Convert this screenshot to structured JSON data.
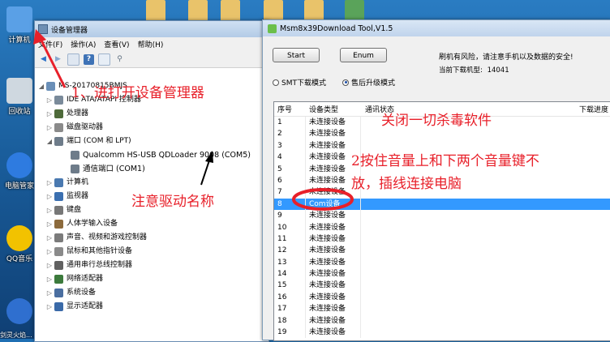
{
  "desktop": {
    "icons": [
      {
        "label": "计算机",
        "icon": "computer-icon",
        "color": "#5aa0e6"
      },
      {
        "label": "回收站",
        "icon": "recycle-bin-icon",
        "color": "#cfd8e0"
      },
      {
        "label": "电脑管家",
        "icon": "pc-manager-shield-icon",
        "color": "#2e7be0"
      },
      {
        "label": "QQ音乐",
        "icon": "qq-music-icon",
        "color": "#f2c200"
      },
      {
        "label": "",
        "icon": "sogou-icon",
        "color": "#2f6fcf"
      }
    ],
    "bottom_label": "剑灵火焰..."
  },
  "device_manager": {
    "title": "设备管理器",
    "menu": [
      "文件(F)",
      "操作(A)",
      "查看(V)",
      "帮助(H)"
    ],
    "toolbar_icons": [
      "back-arrow-icon",
      "forward-arrow-icon",
      "properties-icon",
      "help-icon",
      "view-icon",
      "scan-hardware-icon"
    ],
    "tree": [
      {
        "label": "MS-20170815BMJS",
        "level": 0,
        "expander": "◢",
        "icon": "computer-icon",
        "color": "#6a8fb8"
      },
      {
        "label": "IDE ATA/ATAPI 控制器",
        "level": 1,
        "expander": "▷",
        "icon": "ide-controller-icon",
        "color": "#7a8a9a"
      },
      {
        "label": "处理器",
        "level": 1,
        "expander": "▷",
        "icon": "processor-icon",
        "color": "#4e6a3a"
      },
      {
        "label": "磁盘驱动器",
        "level": 1,
        "expander": "▷",
        "icon": "disk-drive-icon",
        "color": "#8a8a8a"
      },
      {
        "label": "端口 (COM 和 LPT)",
        "level": 1,
        "expander": "◢",
        "icon": "port-icon",
        "color": "#6e7c8a"
      },
      {
        "label": "Qualcomm HS-USB QDLoader 9008 (COM5)",
        "level": 2,
        "expander": "",
        "icon": "port-device-icon",
        "color": "#6e7c8a"
      },
      {
        "label": "通信端口 (COM1)",
        "level": 2,
        "expander": "",
        "icon": "port-device-icon",
        "color": "#6e7c8a"
      },
      {
        "label": "计算机",
        "level": 1,
        "expander": "▷",
        "icon": "computer-node-icon",
        "color": "#4a79b0"
      },
      {
        "label": "监视器",
        "level": 1,
        "expander": "▷",
        "icon": "monitor-icon",
        "color": "#3b6fb0"
      },
      {
        "label": "键盘",
        "level": 1,
        "expander": "▷",
        "icon": "keyboard-icon",
        "color": "#777777"
      },
      {
        "label": "人体学输入设备",
        "level": 1,
        "expander": "▷",
        "icon": "hid-icon",
        "color": "#8c6a3c"
      },
      {
        "label": "声音、视频和游戏控制器",
        "level": 1,
        "expander": "▷",
        "icon": "sound-icon",
        "color": "#7b7b7b"
      },
      {
        "label": "鼠标和其他指针设备",
        "level": 1,
        "expander": "▷",
        "icon": "mouse-icon",
        "color": "#8a8a8a"
      },
      {
        "label": "通用串行总线控制器",
        "level": 1,
        "expander": "▷",
        "icon": "usb-icon",
        "color": "#606060"
      },
      {
        "label": "网络适配器",
        "level": 1,
        "expander": "▷",
        "icon": "network-adapter-icon",
        "color": "#3c7a3c"
      },
      {
        "label": "系统设备",
        "level": 1,
        "expander": "▷",
        "icon": "system-device-icon",
        "color": "#4a6ea0"
      },
      {
        "label": "显示适配器",
        "level": 1,
        "expander": "▷",
        "icon": "display-adapter-icon",
        "color": "#3a6aa8"
      }
    ]
  },
  "tool": {
    "title": "Msm8x39Download Tool,V1.5",
    "start_label": "Start",
    "enum_label": "Enum",
    "warning": "刷机有风险，请注意手机以及数据的安全!",
    "model_label": "当前下载机型:",
    "model_value": "14041",
    "mode_smt": "SMT下载模式",
    "mode_aftersale": "售后升级模式",
    "selected_mode": "售后升级模式",
    "columns": {
      "num": "序号",
      "type": "设备类型",
      "status": "通讯状态",
      "progress": "下载进度"
    },
    "rows": [
      {
        "num": "1",
        "type": "未连接设备"
      },
      {
        "num": "2",
        "type": "未连接设备"
      },
      {
        "num": "3",
        "type": "未连接设备"
      },
      {
        "num": "4",
        "type": "未连接设备"
      },
      {
        "num": "5",
        "type": "未连接设备"
      },
      {
        "num": "6",
        "type": "未连接设备"
      },
      {
        "num": "7",
        "type": "未连接设备"
      },
      {
        "num": "8",
        "type": "Com设备",
        "selected": true
      },
      {
        "num": "9",
        "type": "未连接设备"
      },
      {
        "num": "10",
        "type": "未连接设备"
      },
      {
        "num": "11",
        "type": "未连接设备"
      },
      {
        "num": "12",
        "type": "未连接设备"
      },
      {
        "num": "13",
        "type": "未连接设备"
      },
      {
        "num": "14",
        "type": "未连接设备"
      },
      {
        "num": "15",
        "type": "未连接设备"
      },
      {
        "num": "16",
        "type": "未连接设备"
      },
      {
        "num": "17",
        "type": "未连接设备"
      },
      {
        "num": "18",
        "type": "未连接设备"
      },
      {
        "num": "19",
        "type": "未连接设备"
      }
    ],
    "selected_color": "#3399ff"
  },
  "annotations": {
    "step1": "1、进打开设备管理器",
    "driver_note": "注意驱动名称",
    "antivirus": "关闭一切杀毒软件",
    "step2_line1": "2按住音量上和下两个音量键不",
    "step2_line2": "放，插线连接电脑",
    "annotation_color": "#e8202a"
  }
}
